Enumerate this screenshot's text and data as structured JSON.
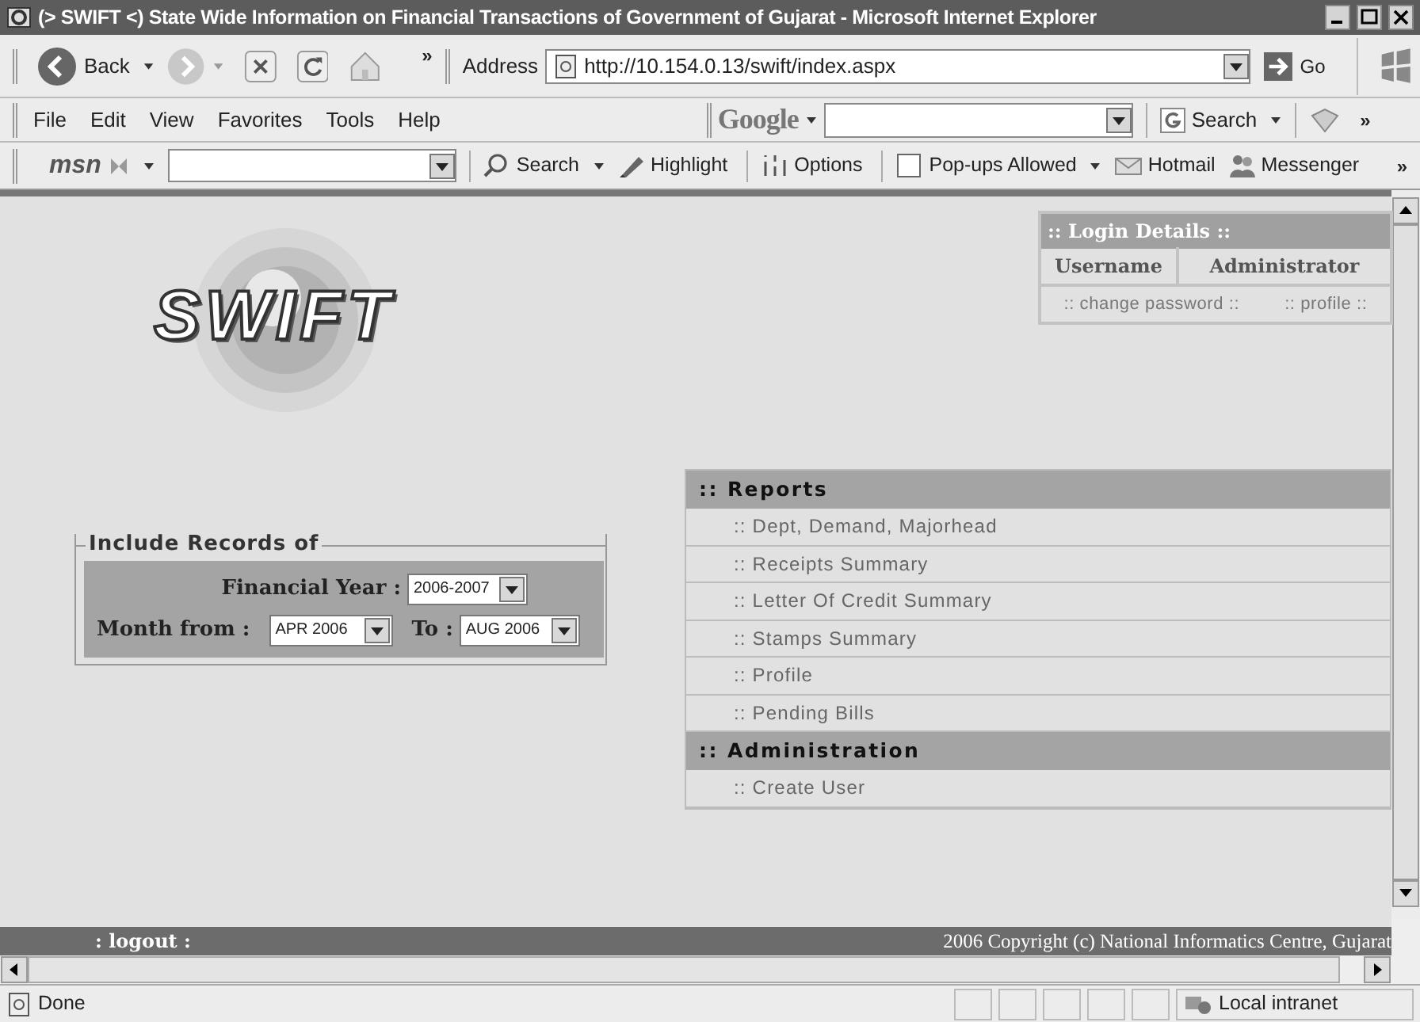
{
  "window": {
    "title": "(> SWIFT <) State Wide Information on Financial Transactions of Government of Gujarat - Microsoft Internet Explorer"
  },
  "nav_bar": {
    "back": "Back",
    "more": "»",
    "address_label": "Address",
    "url": "http://10.154.0.13/swift/index.aspx",
    "go": "Go"
  },
  "menu": [
    "File",
    "Edit",
    "View",
    "Favorites",
    "Tools",
    "Help"
  ],
  "google_bar": {
    "logo": "Google",
    "search": "Search",
    "more": "»"
  },
  "msn_bar": {
    "logo": "msn",
    "items": [
      {
        "kind": "search",
        "label": "Search"
      },
      {
        "kind": "highlight",
        "label": "Highlight"
      },
      {
        "kind": "options",
        "label": "Options"
      },
      {
        "kind": "popups",
        "label": "Pop-ups Allowed"
      },
      {
        "kind": "hotmail",
        "label": "Hotmail"
      },
      {
        "kind": "messenger",
        "label": "Messenger"
      }
    ],
    "more": "»"
  },
  "page": {
    "logo": "SWIFT",
    "login": {
      "title": ":: Login Details ::",
      "username_label": "Username",
      "username": "Administrator",
      "links": [
        ":: change password ::",
        ":: profile ::"
      ]
    },
    "records": {
      "legend": "Include Records of",
      "financial_year_label": "Financial Year :",
      "financial_year": "2006-2007",
      "month_from_label": "Month from :",
      "month_from": "APR 2006",
      "to_label": "To :",
      "to": "AUG 2006"
    },
    "sections": [
      {
        "title": ":: Reports",
        "items": [
          ":: Dept, Demand, Majorhead",
          ":: Receipts Summary",
          ":: Letter Of Credit Summary",
          ":: Stamps Summary",
          ":: Profile",
          ":: Pending Bills"
        ]
      },
      {
        "title": ":: Administration",
        "items": [
          ":: Create User"
        ]
      }
    ],
    "footer": {
      "logout": ": logout :",
      "copyright": "2006 Copyright (c) National Informatics Centre, Gujarat"
    }
  },
  "status_bar": {
    "text": "Done",
    "zone": "Local intranet"
  }
}
